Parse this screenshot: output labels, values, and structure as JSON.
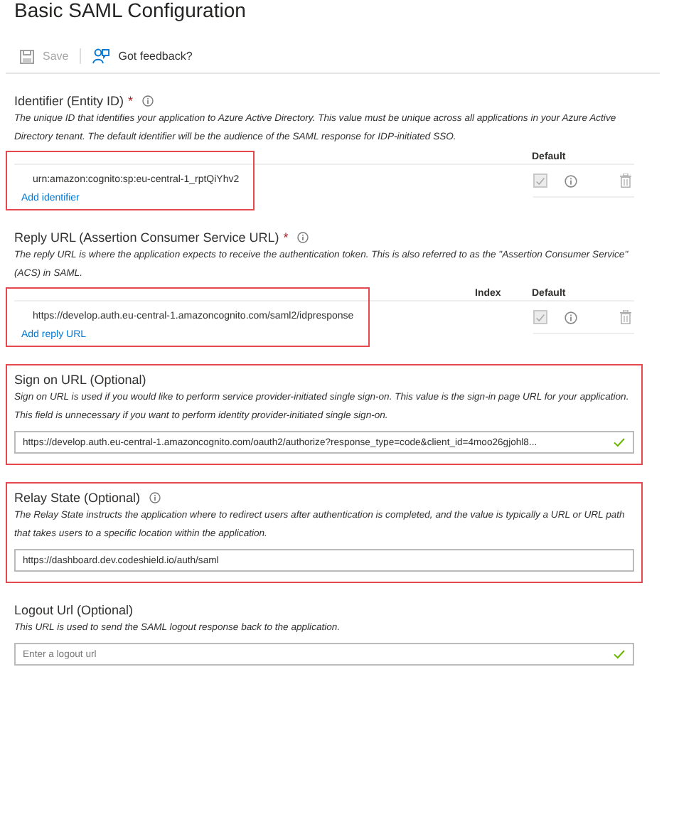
{
  "title": "Basic SAML Configuration",
  "toolbar": [
    {
      "kind": "save",
      "label": "Save",
      "disabled": true
    },
    {
      "kind": "feedback",
      "label": "Got feedback?",
      "disabled": false
    }
  ],
  "sections": [
    {
      "kind": "table",
      "label": "Identifier (Entity ID)",
      "required_mark": "*",
      "info": true,
      "highlighted": true,
      "description": "The unique ID that identifies your application to Azure Active Directory. This value must be unique across all applications in your Azure Active Directory tenant. The default identifier will be the audience of the SAML response for IDP-initiated SSO.",
      "columns": [
        "Default"
      ],
      "rows": [
        {
          "value": "urn:amazon:cognito:sp:eu-central-1_rptQiYhv2",
          "checked": true
        }
      ],
      "add_link": "Add identifier"
    },
    {
      "kind": "table",
      "label": "Reply URL (Assertion Consumer Service URL)",
      "required_mark": "*",
      "info": true,
      "highlighted": true,
      "description": "The reply URL is where the application expects to receive the authentication token. This is also referred to as the \"Assertion Consumer Service\" (ACS) in SAML.",
      "columns": [
        "Index",
        "Default"
      ],
      "rows": [
        {
          "value": "https://develop.auth.eu-central-1.amazoncognito.com/saml2/idpresponse",
          "checked": true
        }
      ],
      "add_link": "Add reply URL"
    },
    {
      "kind": "field",
      "label": "Sign on URL (Optional)",
      "highlighted": true,
      "description": "Sign on URL is used if you would like to perform service provider-initiated single sign-on. This value is the sign-in page URL for your application. This field is unnecessary if you want to perform identity provider-initiated single sign-on.",
      "value": "https://develop.auth.eu-central-1.amazoncognito.com/oauth2/authorize?response_type=code&client_id=4moo26gjohl8...",
      "valid": true
    },
    {
      "kind": "field",
      "label": "Relay State (Optional)",
      "info": true,
      "highlighted": true,
      "description": "The Relay State instructs the application where to redirect users after authentication is completed, and the value is typically a URL or URL path that takes users to a specific location within the application.",
      "value": "https://dashboard.dev.codeshield.io/auth/saml"
    },
    {
      "kind": "field",
      "label": "Logout Url (Optional)",
      "description": "This URL is used to send the SAML logout response back to the application.",
      "placeholder": "Enter a logout url",
      "valid": true
    }
  ]
}
